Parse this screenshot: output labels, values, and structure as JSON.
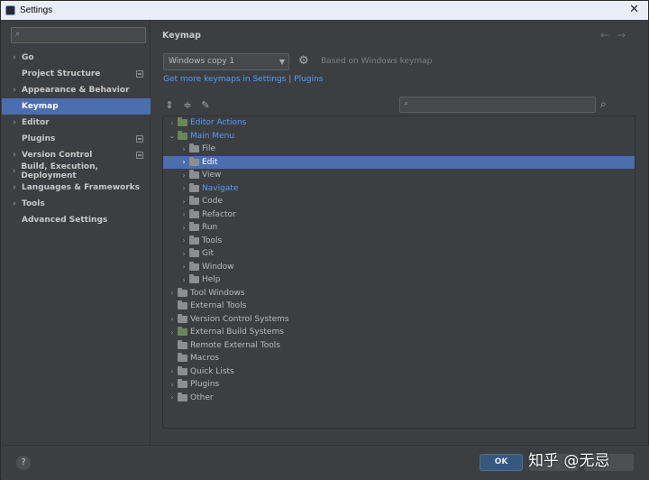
{
  "window": {
    "title": "Settings",
    "close_glyph": "✕"
  },
  "sidebar": {
    "search_placeholder": "",
    "items": [
      {
        "label": "Go",
        "arrow": true,
        "badge": false,
        "selected": false
      },
      {
        "label": "Project Structure",
        "arrow": false,
        "badge": true,
        "selected": false
      },
      {
        "label": "Appearance & Behavior",
        "arrow": true,
        "badge": false,
        "selected": false
      },
      {
        "label": "Keymap",
        "arrow": false,
        "badge": false,
        "selected": true
      },
      {
        "label": "Editor",
        "arrow": true,
        "badge": false,
        "selected": false
      },
      {
        "label": "Plugins",
        "arrow": false,
        "badge": true,
        "selected": false
      },
      {
        "label": "Version Control",
        "arrow": true,
        "badge": true,
        "selected": false
      },
      {
        "label": "Build, Execution, Deployment",
        "arrow": true,
        "badge": false,
        "selected": false
      },
      {
        "label": "Languages & Frameworks",
        "arrow": true,
        "badge": false,
        "selected": false
      },
      {
        "label": "Tools",
        "arrow": true,
        "badge": false,
        "selected": false
      },
      {
        "label": "Advanced Settings",
        "arrow": false,
        "badge": false,
        "selected": false
      }
    ]
  },
  "keymap": {
    "heading": "Keymap",
    "selected_keymap": "Windows copy 1",
    "based_on": "Based on Windows keymap",
    "link_more": "Get more keymaps in Settings",
    "link_sep": "|",
    "link_plugins": "Plugins",
    "tree": [
      {
        "label": "Editor Actions",
        "level": 0,
        "chev": "›",
        "icon": "green",
        "blue": true,
        "selected": false
      },
      {
        "label": "Main Menu",
        "level": 0,
        "chev": "⌄",
        "icon": "green",
        "blue": true,
        "selected": false
      },
      {
        "label": "File",
        "level": 1,
        "chev": "›",
        "icon": "folder",
        "blue": false,
        "selected": false
      },
      {
        "label": "Edit",
        "level": 1,
        "chev": "›",
        "icon": "folder",
        "blue": false,
        "selected": true
      },
      {
        "label": "View",
        "level": 1,
        "chev": "›",
        "icon": "folder",
        "blue": false,
        "selected": false
      },
      {
        "label": "Navigate",
        "level": 1,
        "chev": "›",
        "icon": "folder",
        "blue": true,
        "selected": false
      },
      {
        "label": "Code",
        "level": 1,
        "chev": "›",
        "icon": "folder",
        "blue": false,
        "selected": false
      },
      {
        "label": "Refactor",
        "level": 1,
        "chev": "›",
        "icon": "folder",
        "blue": false,
        "selected": false
      },
      {
        "label": "Run",
        "level": 1,
        "chev": "›",
        "icon": "folder",
        "blue": false,
        "selected": false
      },
      {
        "label": "Tools",
        "level": 1,
        "chev": "›",
        "icon": "folder",
        "blue": false,
        "selected": false
      },
      {
        "label": "Git",
        "level": 1,
        "chev": "›",
        "icon": "folder",
        "blue": false,
        "selected": false
      },
      {
        "label": "Window",
        "level": 1,
        "chev": "›",
        "icon": "folder",
        "blue": false,
        "selected": false
      },
      {
        "label": "Help",
        "level": 1,
        "chev": "›",
        "icon": "folder",
        "blue": false,
        "selected": false
      },
      {
        "label": "Tool Windows",
        "level": 0,
        "chev": "›",
        "icon": "folder",
        "blue": false,
        "selected": false
      },
      {
        "label": "External Tools",
        "level": 0,
        "chev": "",
        "icon": "folder",
        "blue": false,
        "selected": false
      },
      {
        "label": "Version Control Systems",
        "level": 0,
        "chev": "›",
        "icon": "folder",
        "blue": false,
        "selected": false
      },
      {
        "label": "External Build Systems",
        "level": 0,
        "chev": "›",
        "icon": "green",
        "blue": false,
        "selected": false
      },
      {
        "label": "Remote External Tools",
        "level": 0,
        "chev": "",
        "icon": "folder",
        "blue": false,
        "selected": false
      },
      {
        "label": "Macros",
        "level": 0,
        "chev": "",
        "icon": "folder",
        "blue": false,
        "selected": false
      },
      {
        "label": "Quick Lists",
        "level": 0,
        "chev": "›",
        "icon": "folder",
        "blue": false,
        "selected": false
      },
      {
        "label": "Plugins",
        "level": 0,
        "chev": "›",
        "icon": "folder",
        "blue": false,
        "selected": false
      },
      {
        "label": "Other",
        "level": 0,
        "chev": "›",
        "icon": "folder",
        "blue": false,
        "selected": false
      }
    ]
  },
  "footer": {
    "help": "?",
    "ok_label": "OK",
    "watermark": "知乎 @无忌"
  },
  "colors": {
    "selection": "#4b6eaf",
    "link": "#589df6",
    "panel": "#3c3f41"
  }
}
